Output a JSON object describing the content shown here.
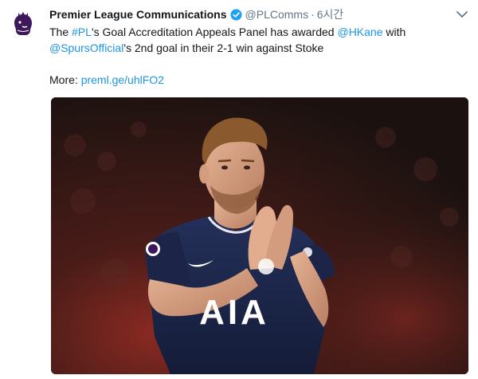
{
  "tweet": {
    "author_name": "Premier League Communications",
    "handle": "@PLComms",
    "separator": "·",
    "time": "6시간",
    "line1": {
      "pre": "The ",
      "hashtag": "#PL",
      "mid": "'s Goal Accreditation Appeals Panel has awarded ",
      "mention": "@HKane",
      "post": " with"
    },
    "line2": {
      "mention": "@SpursOfficial",
      "post": "'s 2nd goal in their 2-1 win against Stoke"
    },
    "more": {
      "label": "More: ",
      "link": "preml.ge/uhlFO2"
    },
    "photo": {
      "sponsor_text": "AIA"
    }
  },
  "colors": {
    "link": "#1b95e0",
    "verified": "#1da1f2",
    "pl_purple": "#3d195b",
    "shirt_navy": "#1a2446"
  },
  "icons": [
    "premier-league-lion-icon",
    "verified-badge-icon",
    "chevron-down-icon"
  ]
}
